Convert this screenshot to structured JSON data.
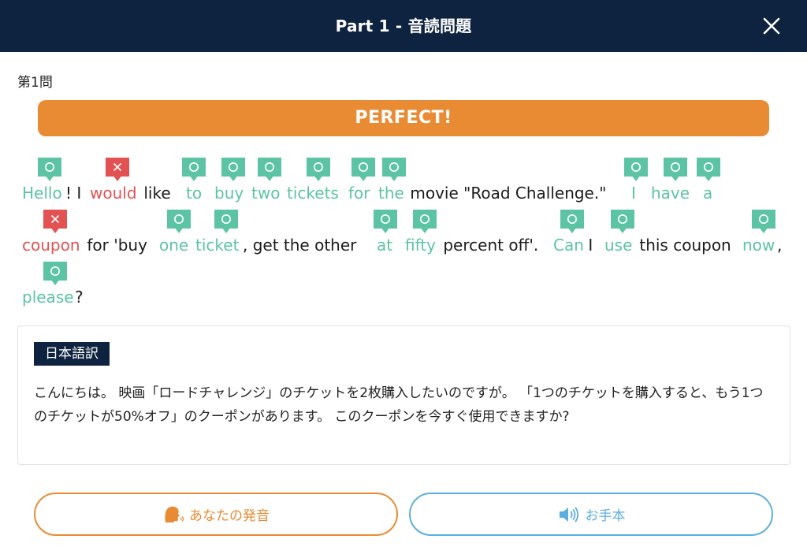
{
  "header": {
    "title": "Part 1 - 音読問題"
  },
  "question": {
    "label": "第1問"
  },
  "result": {
    "text": "PERFECT!"
  },
  "marks": {
    "ok_symbol": "○",
    "ng_symbol": "×",
    "ok_color": "#5cc4a4",
    "ng_color": "#e35252"
  },
  "sentence": {
    "words": [
      {
        "text": "Hello",
        "status": "ok"
      },
      {
        "text": "! I ",
        "status": "plain"
      },
      {
        "text": "would",
        "status": "ng"
      },
      {
        "text": " like ",
        "status": "plain"
      },
      {
        "text": "to",
        "status": "ok"
      },
      {
        "text": "buy",
        "status": "ok"
      },
      {
        "text": "two",
        "status": "ok"
      },
      {
        "text": "tickets",
        "status": "ok"
      },
      {
        "text": "for",
        "status": "ok"
      },
      {
        "text": "the",
        "status": "ok"
      },
      {
        "text": " movie \"Road Challenge.\" ",
        "status": "plain"
      },
      {
        "text": "I",
        "status": "ok"
      },
      {
        "text": "have",
        "status": "ok"
      },
      {
        "text": "a",
        "status": "ok"
      },
      {
        "text": "coupon",
        "status": "ng"
      },
      {
        "text": " for 'buy ",
        "status": "plain"
      },
      {
        "text": "one",
        "status": "ok"
      },
      {
        "text": "ticket",
        "status": "ok"
      },
      {
        "text": ", get the other ",
        "status": "plain"
      },
      {
        "text": "at",
        "status": "ok"
      },
      {
        "text": "fifty",
        "status": "ok"
      },
      {
        "text": " percent off'. ",
        "status": "plain"
      },
      {
        "text": "Can",
        "status": "ok"
      },
      {
        "text": " I ",
        "status": "plain"
      },
      {
        "text": "use",
        "status": "ok"
      },
      {
        "text": " this coupon ",
        "status": "plain"
      },
      {
        "text": "now",
        "status": "ok"
      },
      {
        "text": ",",
        "status": "plain"
      },
      {
        "text": "please",
        "status": "ok"
      },
      {
        "text": "?",
        "status": "plain"
      }
    ]
  },
  "translation": {
    "tag": "日本語訳",
    "text": "こんにちは。 映画「ロードチャレンジ」のチケットを2枚購入したいのですが。 「1つのチケットを購入すると、もう1つのチケットが50%オフ」のクーポンがあります。 このクーポンを今すぐ使用できますか?"
  },
  "buttons": {
    "your_pronunciation": "あなたの発音",
    "model": "お手本",
    "your_color": "#e98b33",
    "model_color": "#5caee0"
  }
}
